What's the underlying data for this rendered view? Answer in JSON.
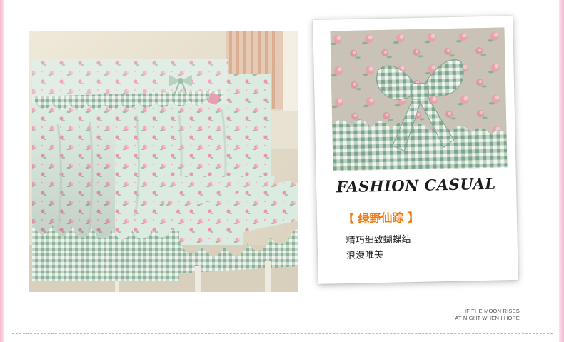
{
  "card": {
    "title": "FASHION CASUAL",
    "tag": "【 绿野仙踪 】",
    "desc_line1": "精巧细致蝴蝶结",
    "desc_line2": "浪漫唯美"
  },
  "tagline": {
    "line1": "IF THE MOON RISES",
    "line2": "AT NIGHT WHEN I HOPE"
  },
  "colors": {
    "accent_orange": "#ef7a14",
    "fabric_mint": "#cfe0d2",
    "gingham_green": "#9fbfa8",
    "rose_pink": "#e9a0ae",
    "page_edge_pink": "#f3b7cf"
  }
}
